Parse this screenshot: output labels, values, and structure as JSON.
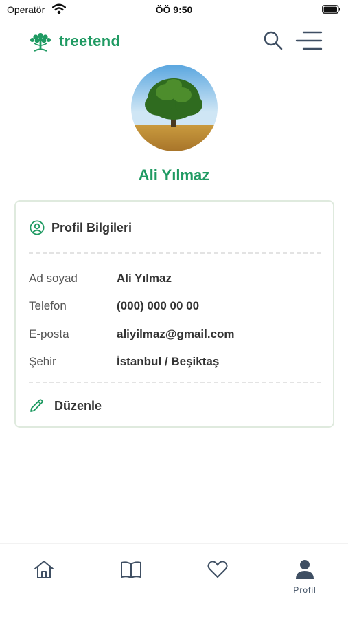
{
  "status_bar": {
    "carrier": "Operatör",
    "time": "ÖÖ 9:50"
  },
  "header": {
    "brand_name": "treetend",
    "icons": {
      "logo": "tree-logo-icon",
      "search": "search-icon",
      "menu": "menu-icon"
    }
  },
  "profile": {
    "name": "Ali Yılmaz"
  },
  "card": {
    "title": "Profil Bilgileri",
    "rows": [
      {
        "label": "Ad soyad",
        "value": "Ali Yılmaz"
      },
      {
        "label": "Telefon",
        "value": "(000) 000 00 00"
      },
      {
        "label": "E-posta",
        "value": "aliyilmaz@gmail.com"
      },
      {
        "label": "Şehir",
        "value": "İstanbul / Beşiktaş"
      }
    ],
    "edit_label": "Düzenle"
  },
  "bottom_nav": {
    "items": [
      {
        "icon": "home-icon",
        "label": ""
      },
      {
        "icon": "book-icon",
        "label": ""
      },
      {
        "icon": "heart-icon",
        "label": ""
      },
      {
        "icon": "user-icon",
        "label": "Profil"
      }
    ]
  },
  "colors": {
    "brand_green": "#1f9a62",
    "nav_icon": "#3f4f63",
    "card_border": "#dfeade"
  }
}
